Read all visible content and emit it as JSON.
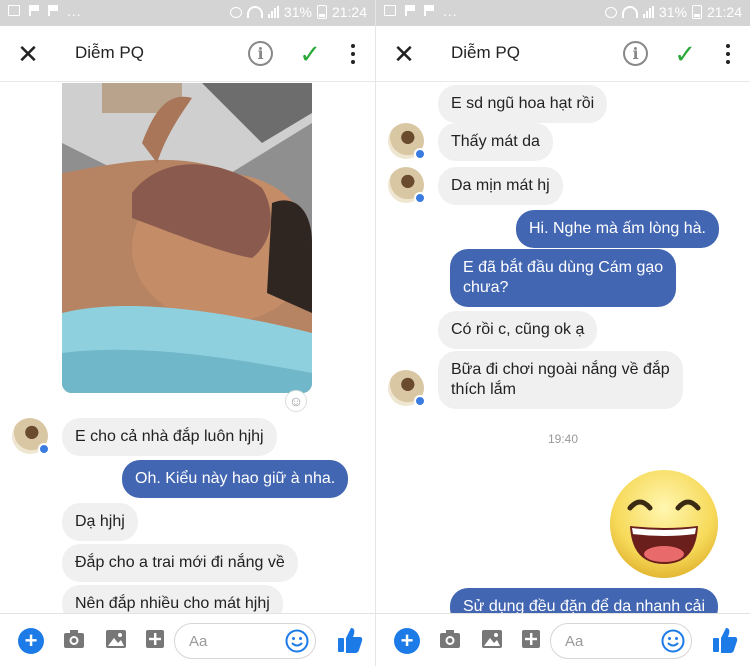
{
  "status_bar": {
    "battery": "31%",
    "time": "21:24"
  },
  "header": {
    "contact_name": "Diễm PQ"
  },
  "composer": {
    "placeholder": "Aa"
  },
  "left_panel": {
    "messages": [
      {
        "type": "incoming",
        "text": "E cho cả nhà đắp luôn hjhj"
      },
      {
        "type": "outgoing",
        "text": "Oh. Kiểu này hao giữ à nha."
      },
      {
        "type": "incoming",
        "text": "Dạ hjhj"
      },
      {
        "type": "incoming",
        "text": "Đắp cho a trai mới đi nắng về"
      },
      {
        "type": "incoming",
        "text": "Nên đắp nhiều cho mát hjhj"
      }
    ]
  },
  "right_panel": {
    "messages": [
      {
        "type": "incoming",
        "text": "E sd ngũ hoa hạt rồi"
      },
      {
        "type": "incoming",
        "text": "Thấy mát da"
      },
      {
        "type": "incoming",
        "text": "Da mịn mát hj"
      },
      {
        "type": "outgoing",
        "text": "Hi. Nghe mà ấm lòng hà."
      },
      {
        "type": "outgoing",
        "line1": "E đã bắt đầu dùng Cám gạo",
        "line2": "chưa?"
      },
      {
        "type": "incoming",
        "text": "Có rồi c,  cũng ok ạ"
      },
      {
        "type": "incoming",
        "line1": "Bữa đi chơi ngoài nắng về đắp",
        "line2": "thích lắm"
      },
      {
        "type": "outgoing",
        "text": "Sử dụng đều đặn để da nhanh cải"
      }
    ],
    "timestamp": "19:40"
  },
  "colors": {
    "outgoing_bubble": "#4266b2",
    "incoming_bubble": "#f0f0f0",
    "accent_blue": "#1d7be7",
    "check_green": "#2aa838",
    "status_bar": "#d4d4d4"
  }
}
